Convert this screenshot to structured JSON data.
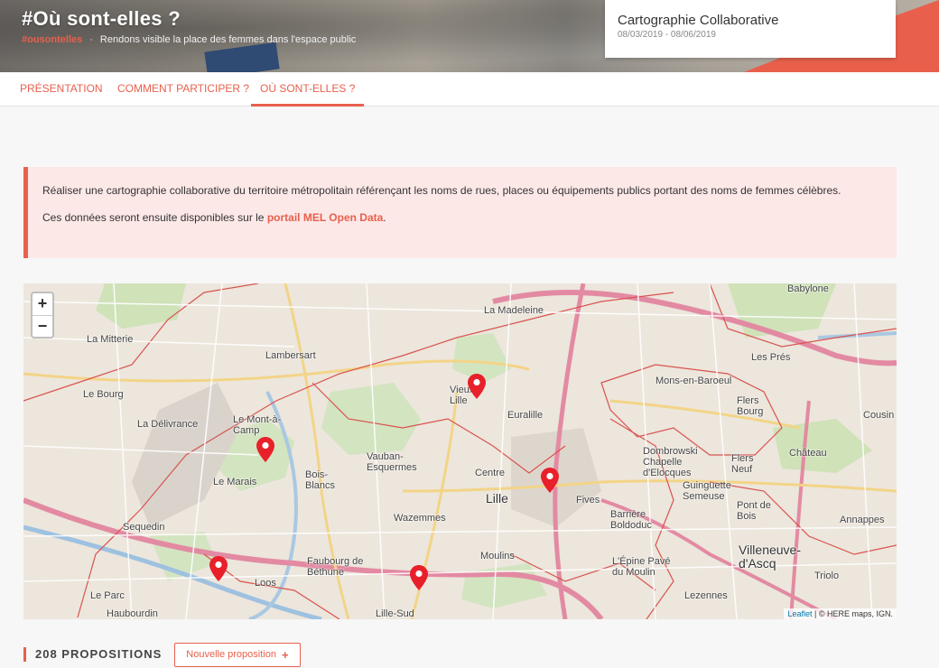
{
  "header": {
    "title": "#Où sont-elles ?",
    "hashtag": "#ousontelles",
    "subtitle": "Rendons visible la place des femmes dans l'espace public"
  },
  "project_card": {
    "title": "Cartographie Collaborative",
    "dates": "08/03/2019 - 08/06/2019"
  },
  "tabs": [
    {
      "label": "PRÉSENTATION",
      "active": false
    },
    {
      "label": "COMMENT PARTICIPER ?",
      "active": false
    },
    {
      "label": "OÙ SONT-ELLES ?",
      "active": true
    }
  ],
  "info": {
    "paragraph1": "Réaliser une cartographie collaborative du territoire métropolitain référençant les noms de rues, places ou équipements publics portant des noms de femmes célèbres.",
    "paragraph2_prefix": "Ces données seront ensuite disponibles sur le ",
    "paragraph2_link": "portail MEL Open Data",
    "paragraph2_suffix": "."
  },
  "map": {
    "zoom_in": "+",
    "zoom_out": "−",
    "places": {
      "lambersart": "Lambersart",
      "la_madeleine": "La Madeleine",
      "mons_en_baroeul": "Mons-en-Baroeul",
      "lille": "Lille",
      "euralille": "Euralille",
      "vieux_lille": "Vieux-Lille",
      "le_bourg": "Le Bourg",
      "la_mitterie": "La Mitterie",
      "la_delivrance": "La Délivrance",
      "le_mont_a_camp": "Le Mont-à-Camp",
      "vauban": "Vauban-Esquermes",
      "centre": "Centre",
      "fives": "Fives",
      "wazemmes": "Wazemmes",
      "moulins": "Moulins",
      "faubourg": "Faubourg de Béthune",
      "loos": "Loos",
      "lille_sud": "Lille-Sud",
      "haubourdin": "Haubourdin",
      "sequedin": "Sequedin",
      "le_marais": "Le Marais",
      "bois_blancs": "Bois-Blancs",
      "dombrowski": "Dombrowski Chapelle d'Elocques",
      "flers_bourg": "Flers Bourg",
      "flers_neuf": "Flers Neuf",
      "les_pres": "Les Prés",
      "babylone": "Babylone",
      "villeneuve": "Villeneuve-d'Ascq",
      "annappes": "Annappes",
      "triolo": "Triolo",
      "lezennes": "Lezennes",
      "pont_de_bois": "Pont de Bois",
      "barriere": "Barrière Boldoduc",
      "l_epine": "L'Épine Pavé du Moulin",
      "le_parc": "Le Parc",
      "cousin": "Cousin",
      "guinguette": "Guinguette Semeuse",
      "chateau": "Château"
    },
    "attribution_leaflet": "Leaflet",
    "attribution_rest": "| © HERE maps, IGN."
  },
  "footer": {
    "count_label": "208 PROPOSITIONS",
    "new_button": "Nouvelle proposition",
    "new_button_icon": "+"
  },
  "colors": {
    "accent": "#e8604c",
    "marker": "#e8202a",
    "info_bg": "#fde8e8"
  }
}
